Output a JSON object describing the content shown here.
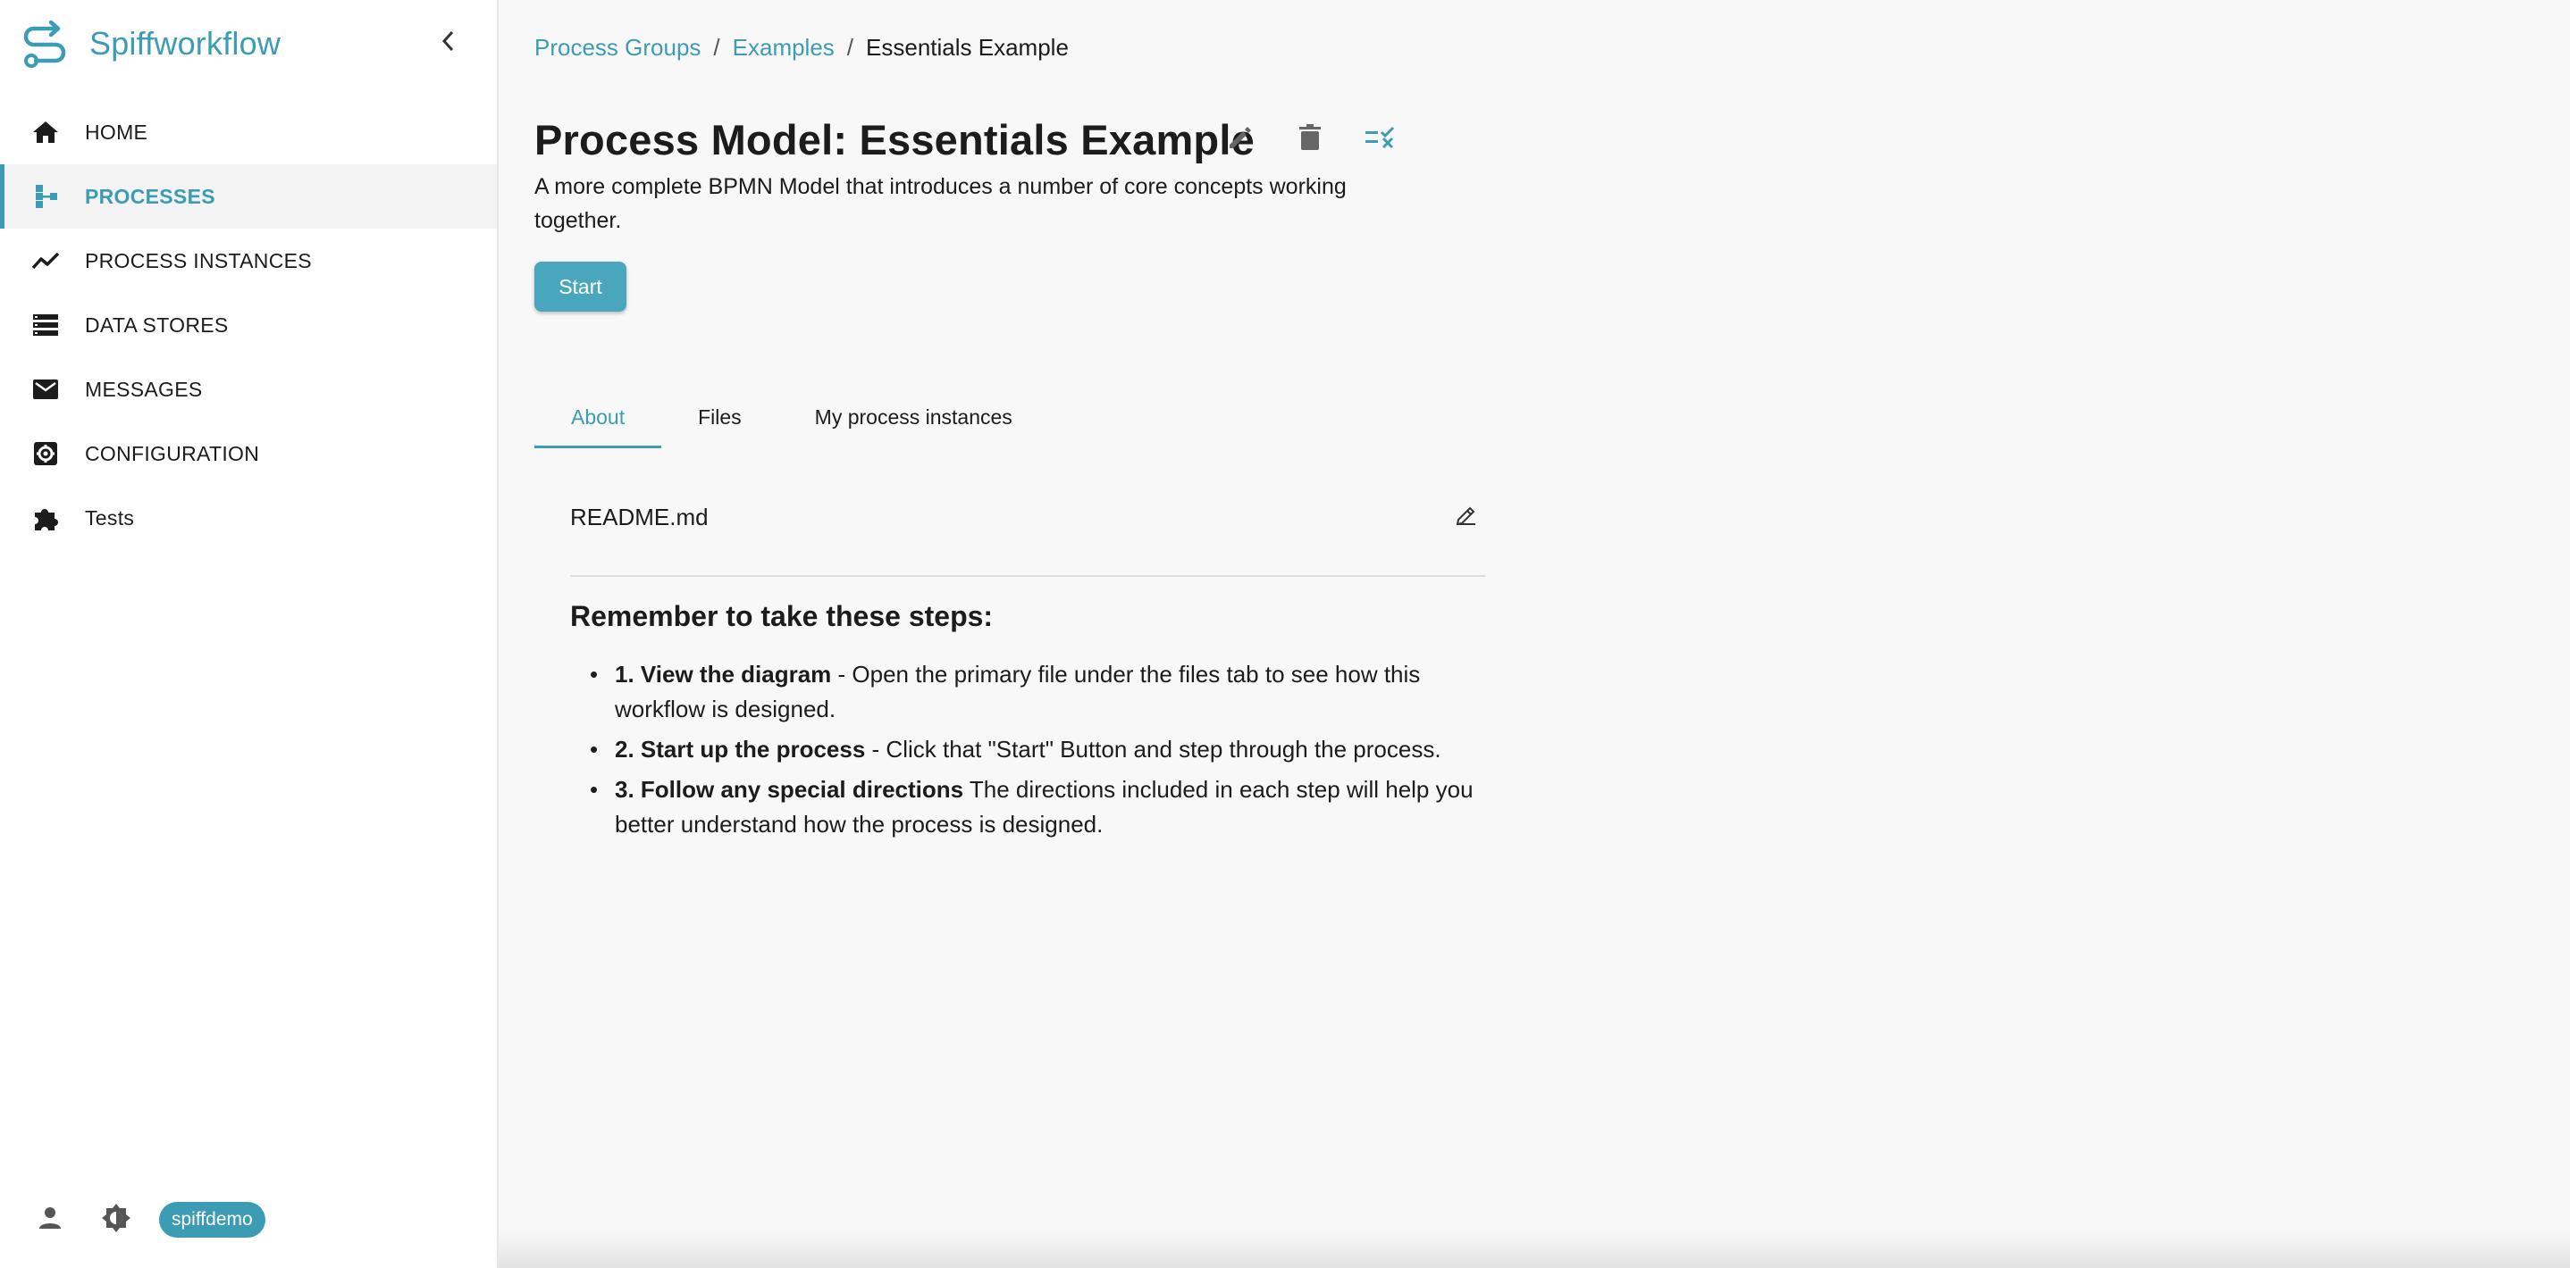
{
  "app": {
    "name": "Spiffworkflow"
  },
  "colors": {
    "accent": "#3b9cb3",
    "button": "#4aa6bd",
    "text": "#1c1c1c"
  },
  "sidebar": {
    "collapse_icon": "chevron-left-icon",
    "items": [
      {
        "label": "HOME",
        "icon": "home-icon",
        "active": false
      },
      {
        "label": "PROCESSES",
        "icon": "process-tree-icon",
        "active": true
      },
      {
        "label": "PROCESS INSTANCES",
        "icon": "trend-line-icon",
        "active": false
      },
      {
        "label": "DATA STORES",
        "icon": "storage-icon",
        "active": false
      },
      {
        "label": "MESSAGES",
        "icon": "mail-icon",
        "active": false
      },
      {
        "label": "CONFIGURATION",
        "icon": "settings-icon",
        "active": false
      },
      {
        "label": "Tests",
        "icon": "puzzle-icon",
        "active": false
      }
    ],
    "footer": {
      "user_icon": "person-icon",
      "theme_icon": "brightness-icon",
      "username": "spiffdemo"
    }
  },
  "breadcrumb": {
    "items": [
      "Process Groups",
      "Examples"
    ],
    "current": "Essentials Example",
    "separator": "/"
  },
  "page": {
    "title": "Process Model: Essentials Example",
    "description": "A more complete BPMN Model that introduces a number of core concepts working together.",
    "start_label": "Start",
    "actions": [
      "edit-icon",
      "delete-icon",
      "checklist-icon"
    ]
  },
  "tabs": [
    {
      "label": "About",
      "active": true
    },
    {
      "label": "Files",
      "active": false
    },
    {
      "label": "My process instances",
      "active": false
    }
  ],
  "readme": {
    "filename": "README.md",
    "heading": "Remember to take these steps:",
    "steps": [
      {
        "bold": "1. View the diagram",
        "text": " - Open the primary file under the files tab to see how this workflow is designed."
      },
      {
        "bold": "2. Start up the process",
        "text": " - Click that \"Start\" Button and step through the process."
      },
      {
        "bold": "3. Follow any special directions",
        "text": " The directions included in each step will help you better understand how the process is designed."
      }
    ]
  }
}
